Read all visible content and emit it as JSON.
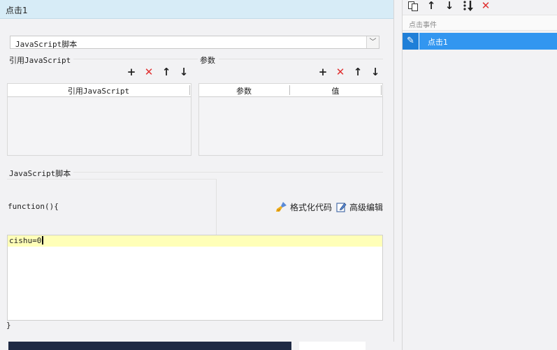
{
  "title_bar": {
    "title": "点击1"
  },
  "js_select": {
    "value": "JavaScript脚本",
    "arrow": "﹀"
  },
  "ref_js": {
    "label": "引用JavaScript",
    "column_header": "引用JavaScript",
    "rows": []
  },
  "params": {
    "label": "参数",
    "columns": [
      "参数",
      "值"
    ],
    "rows": []
  },
  "toolbar_glyphs": {
    "add": "+",
    "delete": "✕",
    "up": "↑",
    "down": "↓"
  },
  "script": {
    "label": "JavaScript脚本",
    "func_open": "function(){",
    "func_close": "}",
    "code": "cishu=0",
    "format_label": "格式化代码",
    "advanced_label": "高级编辑"
  },
  "events": {
    "header": "点击事件",
    "items": [
      {
        "label": "点击1",
        "selected": true
      }
    ]
  },
  "colors": {
    "accent": "#3296f0",
    "title_bg": "#d7ecf7",
    "delete_red": "#e03131",
    "code_highlight": "#ffffb8"
  }
}
